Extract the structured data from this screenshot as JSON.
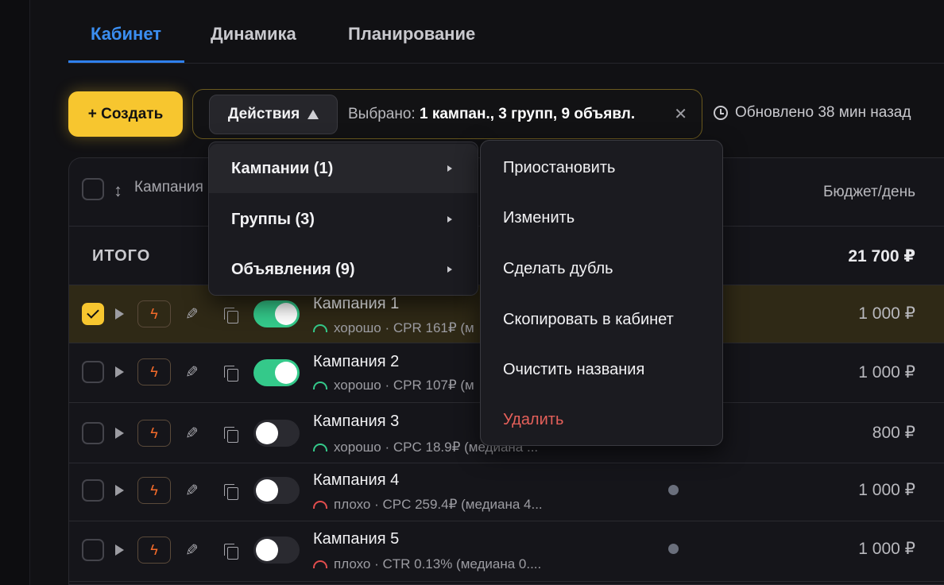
{
  "tabs": [
    {
      "label": "Кабинет",
      "active": true
    },
    {
      "label": "Динамика",
      "active": false
    },
    {
      "label": "Планирование",
      "active": false
    }
  ],
  "toolbar": {
    "create_label": "+ Создать",
    "actions_label": "Действия",
    "selected_prefix": "Выбрано: ",
    "selected_value": "1 кампан., 3 групп, 9 объявл.",
    "clear_symbol": "✕",
    "updated_text": "Обновлено 38 мин назад"
  },
  "table": {
    "header": {
      "campaign": "Кампания",
      "budget": "Бюджет/день"
    },
    "total": {
      "label": "ИТОГО",
      "budget": "21 700 ₽"
    },
    "rows": [
      {
        "name": "Кампания 1",
        "status": "good",
        "sub": "хорошо · CPR 161₽ (м",
        "budget": "1 000 ₽",
        "enabled": true,
        "checked": true
      },
      {
        "name": "Кампания 2",
        "status": "good",
        "sub": "хорошо · CPR 107₽ (м",
        "budget": "1 000 ₽",
        "enabled": true,
        "checked": false
      },
      {
        "name": "Кампания 3",
        "status": "good",
        "sub": "хорошо · CPC 18.9₽ (медиана ...",
        "budget": "800 ₽",
        "enabled": false,
        "checked": false
      },
      {
        "name": "Кампания 4",
        "status": "bad",
        "sub": "плохо · CPC 259.4₽ (медиана 4...",
        "budget": "1 000 ₽",
        "enabled": false,
        "checked": false
      },
      {
        "name": "Кампания 5",
        "status": "bad",
        "sub": "плохо · CTR 0.13% (медиана 0....",
        "budget": "1 000 ₽",
        "enabled": false,
        "checked": false
      }
    ]
  },
  "actions_menu": {
    "categories": [
      {
        "label": "Кампании (1)"
      },
      {
        "label": "Группы (3)"
      },
      {
        "label": "Объявления (9)"
      }
    ],
    "submenu": [
      {
        "label": "Приостановить"
      },
      {
        "label": "Изменить"
      },
      {
        "label": "Сделать дубль"
      },
      {
        "label": "Скопировать в кабинет"
      },
      {
        "label": "Очистить названия"
      },
      {
        "label": "Удалить",
        "danger": true
      }
    ]
  },
  "colors": {
    "accent": "#f7c62f",
    "tab_active": "#3b8ef0",
    "toggle_on": "#34c98a",
    "status_good": "#34c98a",
    "status_bad": "#e24d4d",
    "danger": "#e5605a"
  },
  "icons": [
    "clock-icon",
    "sort-icon",
    "play-icon",
    "bolt-icon",
    "pencil-icon",
    "copy-icon",
    "gauge-icon",
    "chevron-right-icon",
    "close-icon"
  ]
}
